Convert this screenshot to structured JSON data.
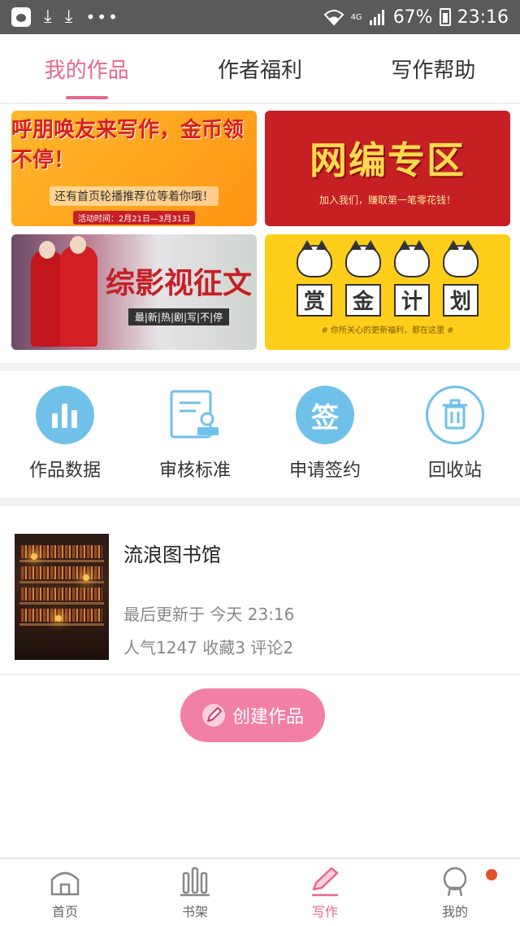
{
  "status_bar": {
    "battery": "67%",
    "time": "23:16",
    "network": "4G"
  },
  "tabs": [
    {
      "label": "我的作品"
    },
    {
      "label": "作者福利"
    },
    {
      "label": "写作帮助"
    }
  ],
  "banners": {
    "invite": {
      "title": "呼朋唤友来写作，金币领不停！",
      "sub": "还有首页轮播推荐位等着你哦！",
      "date": "活动时间：2月21日—3月31日"
    },
    "editor": {
      "title": "网编专区",
      "sub": "加入我们，赚取第一笔零花钱！"
    },
    "drama": {
      "title": "综影视征文",
      "sub": "最|新|热|剧|写|不|停"
    },
    "bounty": {
      "chars": [
        "赏",
        "金",
        "计",
        "划"
      ],
      "sub": "# 你所关心的更新福利，都在这里 #"
    }
  },
  "tools": [
    {
      "label": "作品数据",
      "icon": "bar-chart-icon"
    },
    {
      "label": "审核标准",
      "icon": "document-review-icon"
    },
    {
      "label": "申请签约",
      "icon": "sign-icon"
    },
    {
      "label": "回收站",
      "icon": "trash-icon"
    }
  ],
  "sign_glyph": "签",
  "work": {
    "title": "流浪图书馆",
    "updated": "最后更新于 今天 23:16",
    "stats": "人气1247 收藏3 评论2"
  },
  "create_button": "创建作品",
  "bottom_nav": [
    {
      "label": "首页",
      "icon": "home-icon"
    },
    {
      "label": "书架",
      "icon": "bookshelf-icon"
    },
    {
      "label": "写作",
      "icon": "pencil-icon"
    },
    {
      "label": "我的",
      "icon": "profile-icon"
    }
  ],
  "colors": {
    "accent": "#e8678a",
    "button": "#f17fa6",
    "tool_icon": "#6fc1ea"
  }
}
